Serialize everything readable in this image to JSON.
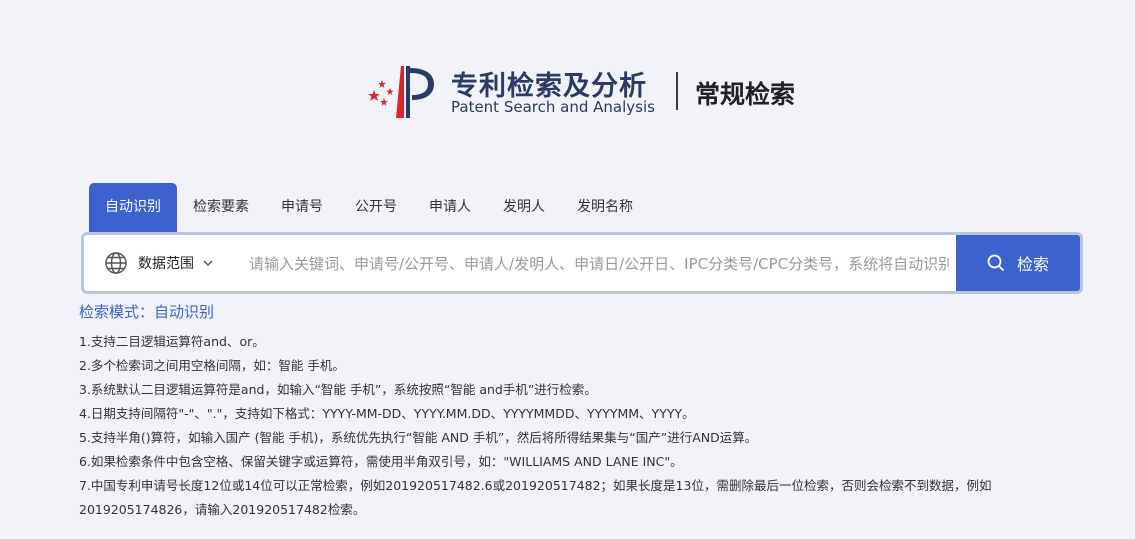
{
  "header": {
    "logo_cn": "专利检索及分析",
    "logo_en": "Patent Search and Analysis",
    "page_title": "常规检索"
  },
  "tabs": [
    {
      "label": "自动识别",
      "active": true
    },
    {
      "label": "检索要素"
    },
    {
      "label": "申请号"
    },
    {
      "label": "公开号"
    },
    {
      "label": "申请人"
    },
    {
      "label": "发明人"
    },
    {
      "label": "发明名称"
    }
  ],
  "search": {
    "scope_label": "数据范围",
    "placeholder": "请输入关键词、申请号/公开号、申请人/发明人、申请日/公开日、IPC分类号/CPC分类号，系统将自动识别",
    "button_label": "检索"
  },
  "help": {
    "mode": "检索模式：自动识别",
    "tips": [
      "1.支持二目逻辑运算符and、or。",
      "2.多个检索词之间用空格间隔，如：智能 手机。",
      "3.系统默认二目逻辑运算符是and，如输入“智能 手机”，系统按照“智能 and手机”进行检索。",
      "4.日期支持间隔符\"-\"、\".\"，支持如下格式：YYYY-MM-DD、YYYY.MM.DD、YYYYMMDD、YYYYMM、YYYY。",
      "5.支持半角()算符，如输入国产 (智能 手机)，系统优先执行“智能 AND 手机”，然后将所得结果集与“国产”进行AND运算。",
      "6.如果检索条件中包含空格、保留关键字或运算符，需使用半角双引号，如：\"WILLIAMS AND LANE INC\"。",
      "7.中国专利申请号长度12位或14位可以正常检索，例如201920517482.6或201920517482；如果长度是13位，需删除最后一位检索，否则会检索不到数据，例如2019205174826，请输入201920517482检索。"
    ]
  },
  "colors": {
    "accent": "#3b62cf",
    "logo_red": "#d7282f",
    "logo_navy": "#2b3a67",
    "background": "#f1f3f8"
  },
  "icons": {
    "logo": "patent-logo-icon",
    "scope": "globe-icon",
    "scope_toggle": "chevron-down-icon",
    "search": "search-icon"
  }
}
